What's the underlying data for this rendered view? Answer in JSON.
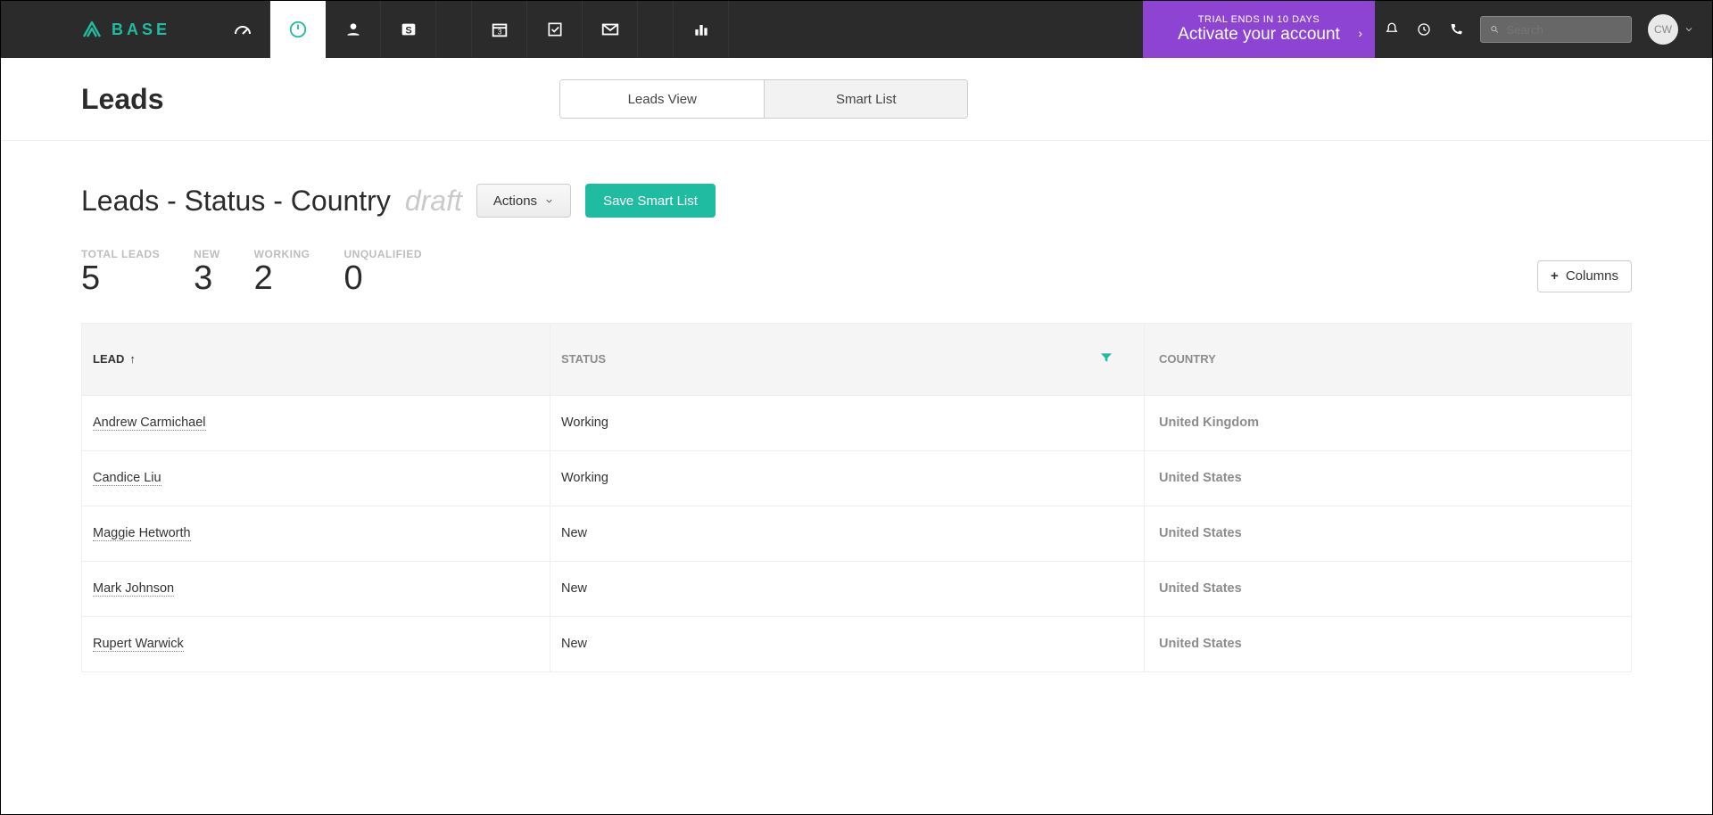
{
  "brand": "BASE",
  "trial": {
    "top": "TRIAL ENDS IN 10 DAYS",
    "main": "Activate your account"
  },
  "search": {
    "placeholder": "Search"
  },
  "avatar_initials": "CW",
  "page_title": "Leads",
  "tabs": {
    "leads_view": "Leads View",
    "smart_list": "Smart List"
  },
  "list_name": "Leads - Status - Country",
  "draft_label": "draft",
  "actions_label": "Actions",
  "save_label": "Save Smart List",
  "columns_label": "Columns",
  "stats": [
    {
      "label": "TOTAL LEADS",
      "value": "5"
    },
    {
      "label": "NEW",
      "value": "3"
    },
    {
      "label": "WORKING",
      "value": "2"
    },
    {
      "label": "UNQUALIFIED",
      "value": "0"
    }
  ],
  "columns": {
    "lead": "LEAD",
    "status": "STATUS",
    "country": "COUNTRY",
    "sort_indicator": "↑"
  },
  "rows": [
    {
      "lead": "Andrew Carmichael",
      "status": "Working",
      "country": "United Kingdom"
    },
    {
      "lead": "Candice Liu",
      "status": "Working",
      "country": "United States"
    },
    {
      "lead": "Maggie Hetworth",
      "status": "New",
      "country": "United States"
    },
    {
      "lead": "Mark Johnson",
      "status": "New",
      "country": "United States"
    },
    {
      "lead": "Rupert Warwick",
      "status": "New",
      "country": "United States"
    }
  ]
}
